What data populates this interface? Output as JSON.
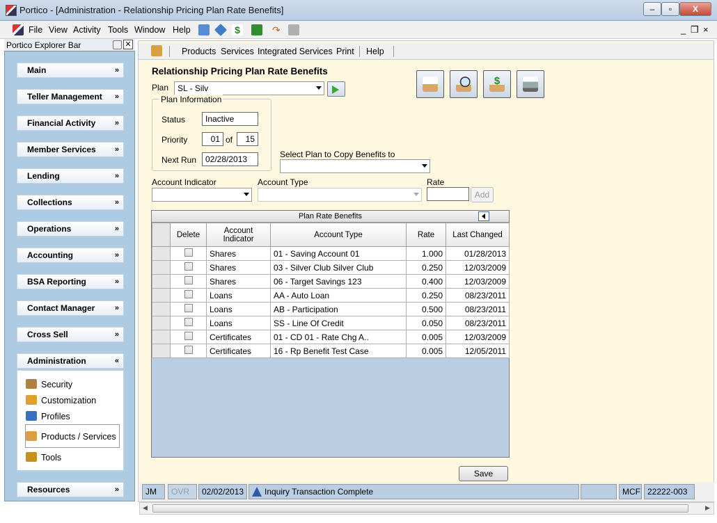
{
  "window": {
    "title": "Portico - [Administration - Relationship Pricing Plan Rate Benefits]",
    "minimize": "–",
    "restore": "▫",
    "close": "X"
  },
  "menubar": {
    "items": [
      "File",
      "View",
      "Activity",
      "Tools",
      "Window",
      "Help"
    ]
  },
  "mdi": {
    "minimize": "_",
    "restore": "❐",
    "close": "×"
  },
  "explorer": {
    "title": "Portico Explorer Bar",
    "categories": [
      "Main",
      "Teller Management",
      "Financial Activity",
      "Member Services",
      "Lending",
      "Collections",
      "Operations",
      "Accounting",
      "BSA Reporting",
      "Contact Manager",
      "Cross Sell",
      "Administration",
      "Resources"
    ],
    "admin_items": [
      "Security",
      "Customization",
      "Profiles",
      "Products / Services",
      "Tools"
    ]
  },
  "content_toolbar": {
    "items": [
      "Products",
      "Services",
      "Integrated Services",
      "Print",
      "Help"
    ]
  },
  "page": {
    "title": "Relationship Pricing Plan Rate Benefits",
    "plan_label": "Plan",
    "plan_value": "SL - Silv",
    "plan_info_label": "Plan Information",
    "status_label": "Status",
    "status_value": "Inactive",
    "priority_label": "Priority",
    "priority_value": "01",
    "priority_of": "of",
    "priority_total": "15",
    "next_run_label": "Next Run",
    "next_run_value": "02/28/2013",
    "copy_label": "Select Plan to Copy Benefits to",
    "account_indicator_label": "Account Indicator",
    "account_type_label": "Account Type",
    "rate_label": "Rate",
    "add_label": "Add",
    "save_label": "Save"
  },
  "grid": {
    "title": "Plan Rate Benefits",
    "headers": {
      "delete": "Delete",
      "indicator_1": "Account",
      "indicator_2": "Indicator",
      "type": "Account Type",
      "rate": "Rate",
      "changed": "Last Changed"
    },
    "rows": [
      {
        "indicator": "Shares",
        "type": "01 - Saving Account 01",
        "rate": "1.000",
        "changed": "01/28/2013"
      },
      {
        "indicator": "Shares",
        "type": "03 - Silver Club Silver Club",
        "rate": "0.250",
        "changed": "12/03/2009"
      },
      {
        "indicator": "Shares",
        "type": "06 - Target Savings 123",
        "rate": "0.400",
        "changed": "12/03/2009"
      },
      {
        "indicator": "Loans",
        "type": "AA - Auto Loan",
        "rate": "0.250",
        "changed": "08/23/2011"
      },
      {
        "indicator": "Loans",
        "type": "AB - Participation",
        "rate": "0.500",
        "changed": "08/23/2011"
      },
      {
        "indicator": "Loans",
        "type": "SS - Line Of Credit",
        "rate": "0.050",
        "changed": "08/23/2011"
      },
      {
        "indicator": "Certificates",
        "type": "01 - CD 01 - Rate Chg A..",
        "rate": "0.005",
        "changed": "12/03/2009"
      },
      {
        "indicator": "Certificates",
        "type": "16 - Rp Benefit Test Case",
        "rate": "0.005",
        "changed": "12/05/2011"
      }
    ]
  },
  "statusbar": {
    "user": "JM",
    "ovr": "OVR",
    "date": "02/02/2013",
    "message": "Inquiry Transaction Complete",
    "code": "MCF",
    "account": "22222-003"
  }
}
